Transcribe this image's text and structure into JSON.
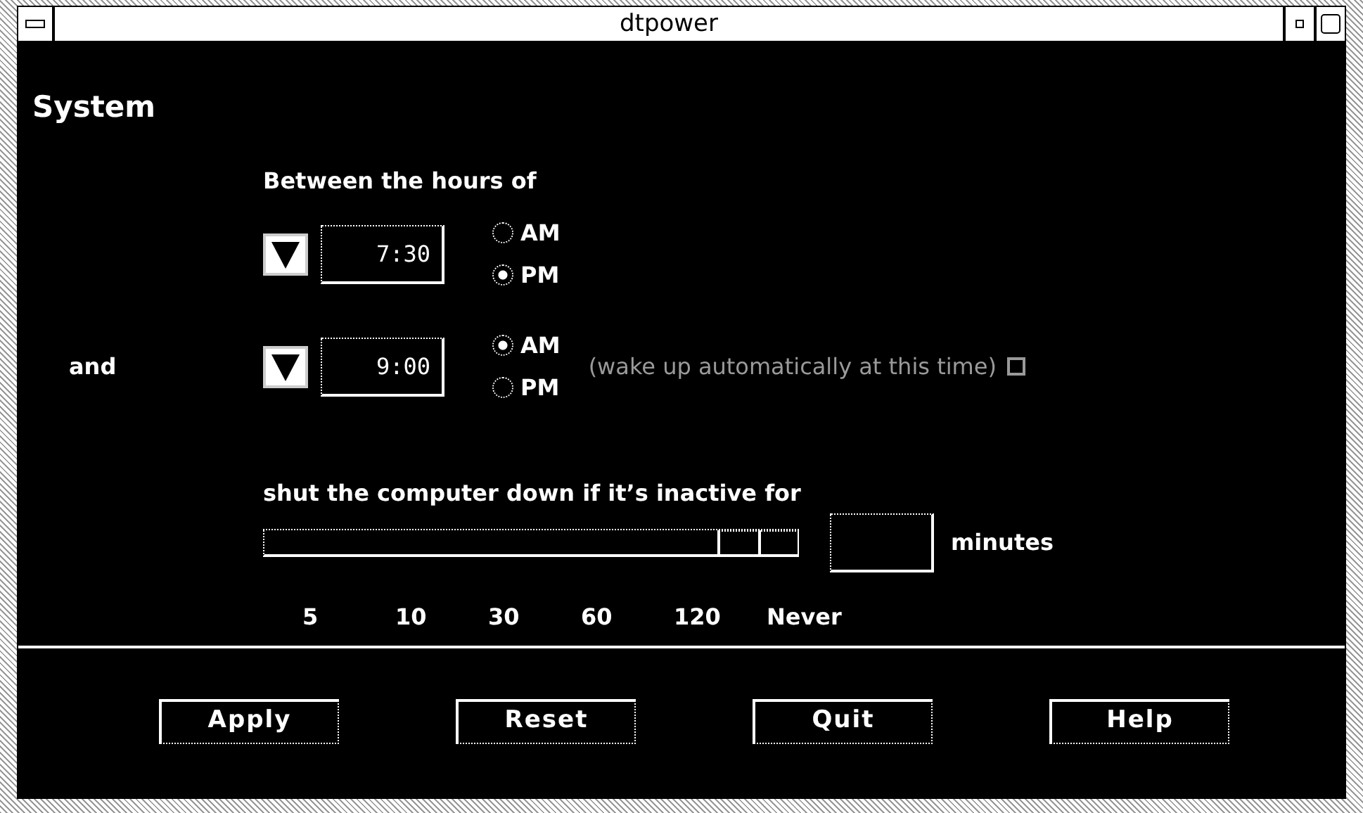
{
  "window": {
    "title": "dtpower"
  },
  "heading": "System",
  "between_label": "Between the hours of",
  "and_label": "and",
  "times": [
    {
      "value": "7:30",
      "options": [
        {
          "label": "AM",
          "selected": false
        },
        {
          "label": "PM",
          "selected": true
        }
      ]
    },
    {
      "value": "9:00",
      "options": [
        {
          "label": "AM",
          "selected": true
        },
        {
          "label": "PM",
          "selected": false
        }
      ]
    }
  ],
  "wake": {
    "label": "(wake up automatically at this time)",
    "checked": false,
    "disabled": true
  },
  "shutdown": {
    "label": "shut the computer down if it’s inactive for",
    "level": 0.92,
    "unit": "minutes",
    "ticks": [
      "5",
      "10",
      "30",
      "60",
      "120",
      "Never"
    ]
  },
  "buttons": [
    {
      "label": "Apply"
    },
    {
      "label": "Reset"
    },
    {
      "label": "Quit"
    },
    {
      "label": "Help"
    }
  ]
}
